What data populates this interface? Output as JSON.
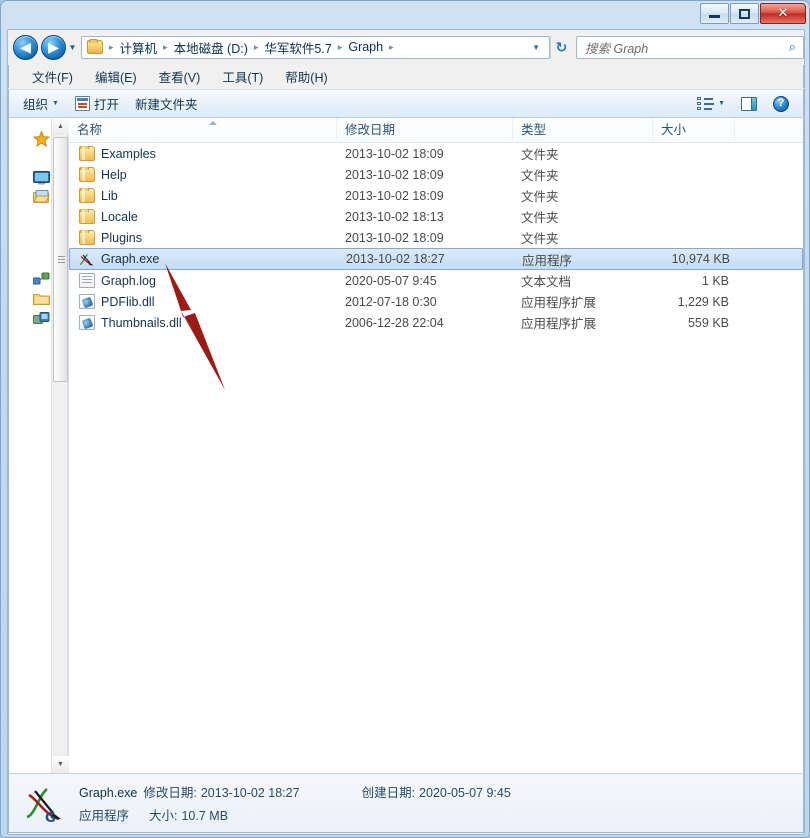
{
  "window": {
    "controls": {
      "minimize": "minimize-button",
      "maximize": "maximize-button",
      "close_label": "✕"
    }
  },
  "address": {
    "back_glyph": "◀",
    "forward_glyph": "▶",
    "history_caret": "▼",
    "dropdown_caret": "▼",
    "refresh_glyph": "↻",
    "crumbs": [
      {
        "label": "计算机"
      },
      {
        "label": "本地磁盘 (D:)"
      },
      {
        "label": "华军软件5.7"
      },
      {
        "label": "Graph"
      }
    ],
    "separator": "▸"
  },
  "search": {
    "placeholder": "搜索 Graph",
    "icon_glyph": "⌕"
  },
  "menubar": {
    "items": [
      {
        "label": "文件(F)"
      },
      {
        "label": "编辑(E)"
      },
      {
        "label": "查看(V)"
      },
      {
        "label": "工具(T)"
      },
      {
        "label": "帮助(H)"
      }
    ]
  },
  "toolbar": {
    "organize_label": "组织",
    "organize_caret": "▼",
    "open_label": "打开",
    "new_folder_label": "新建文件夹",
    "view_caret": "▼",
    "help_glyph": "?"
  },
  "columns": {
    "name": "名称",
    "date": "修改日期",
    "type": "类型",
    "size": "大小"
  },
  "files": [
    {
      "name": "Examples",
      "date": "2013-10-02 18:09",
      "type": "文件夹",
      "size": "",
      "icon": "folder",
      "selected": false
    },
    {
      "name": "Help",
      "date": "2013-10-02 18:09",
      "type": "文件夹",
      "size": "",
      "icon": "folder",
      "selected": false
    },
    {
      "name": "Lib",
      "date": "2013-10-02 18:09",
      "type": "文件夹",
      "size": "",
      "icon": "folder",
      "selected": false
    },
    {
      "name": "Locale",
      "date": "2013-10-02 18:13",
      "type": "文件夹",
      "size": "",
      "icon": "folder",
      "selected": false
    },
    {
      "name": "Plugins",
      "date": "2013-10-02 18:09",
      "type": "文件夹",
      "size": "",
      "icon": "folder",
      "selected": false
    },
    {
      "name": "Graph.exe",
      "date": "2013-10-02 18:27",
      "type": "应用程序",
      "size": "10,974 KB",
      "icon": "graph-app",
      "selected": true
    },
    {
      "name": "Graph.log",
      "date": "2020-05-07 9:45",
      "type": "文本文档",
      "size": "1 KB",
      "icon": "text-file",
      "selected": false
    },
    {
      "name": "PDFlib.dll",
      "date": "2012-07-18 0:30",
      "type": "应用程序扩展",
      "size": "1,229 KB",
      "icon": "dll-file",
      "selected": false
    },
    {
      "name": "Thumbnails.dll",
      "date": "2006-12-28 22:04",
      "type": "应用程序扩展",
      "size": "559 KB",
      "icon": "dll-file",
      "selected": false
    }
  ],
  "status": {
    "file_name": "Graph.exe",
    "modified_label": "修改日期:",
    "modified_value": "2013-10-02 18:27",
    "created_label": "创建日期:",
    "created_value": "2020-05-07 9:45",
    "type_value": "应用程序",
    "size_label": "大小:",
    "size_value": "10.7 MB"
  },
  "annotation": {
    "arrow_color": "#9c1b15"
  }
}
